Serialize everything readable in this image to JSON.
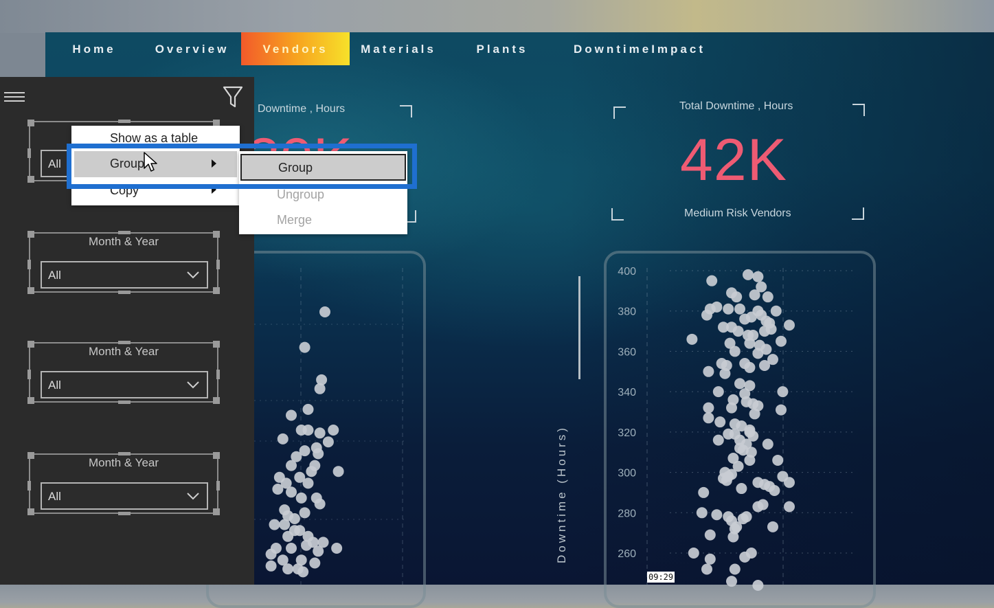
{
  "nav": {
    "tabs": [
      {
        "label": "Home",
        "active": false
      },
      {
        "label": "Overview",
        "active": false
      },
      {
        "label": "Vendors",
        "active": true
      },
      {
        "label": "Materials",
        "active": false
      },
      {
        "label": "Plants",
        "active": false
      },
      {
        "label": "DowntimeImpact",
        "active": false
      }
    ]
  },
  "filter_pane": {
    "menu_icon": "hamburger-icon",
    "filter_icon": "funnel-icon",
    "slicers": [
      {
        "title": "Month & Year",
        "value": "All"
      },
      {
        "title": "Month & Year",
        "value": "All"
      },
      {
        "title": "Month & Year",
        "value": "All"
      },
      {
        "title": "Month & Year",
        "value": "All"
      }
    ]
  },
  "context_menu": {
    "items": [
      {
        "label": "Show as a table",
        "has_submenu": false
      },
      {
        "label": "Group",
        "has_submenu": true,
        "hovered": true
      },
      {
        "label": "Copy",
        "has_submenu": true
      }
    ],
    "submenu": [
      {
        "label": "Group",
        "enabled": true,
        "focused": true
      },
      {
        "label": "Ungroup",
        "enabled": false
      },
      {
        "label": "Merge",
        "enabled": false
      }
    ]
  },
  "kpis": [
    {
      "title": "Downtime , Hours",
      "value": "",
      "subtitle": ""
    },
    {
      "title": "Total Downtime , Hours",
      "value": "42K",
      "subtitle": "Medium Risk Vendors"
    }
  ],
  "colors": {
    "kpi_value": "#ee5b73",
    "active_tab_start": "#f25a2a",
    "active_tab_end": "#f7e12a",
    "highlight": "#1f6fd0",
    "point": "#c8ccd2"
  },
  "timestamp": "09:29",
  "chart_data": [
    {
      "type": "scatter",
      "title": "",
      "xlabel": "",
      "ylabel": "Downtime (Hours)",
      "ylim": [
        240,
        405
      ],
      "xlim": [
        0,
        100
      ],
      "yticks": [
        400,
        380,
        360,
        340,
        320,
        300,
        280,
        260
      ],
      "grid": true,
      "points": [
        [
          38,
          395
        ],
        [
          60,
          398
        ],
        [
          66,
          397
        ],
        [
          68,
          392
        ],
        [
          50,
          389
        ],
        [
          53,
          387
        ],
        [
          64,
          388
        ],
        [
          72,
          387
        ],
        [
          37,
          381
        ],
        [
          41,
          382
        ],
        [
          48,
          381
        ],
        [
          55,
          381
        ],
        [
          66,
          380
        ],
        [
          68,
          378
        ],
        [
          77,
          380
        ],
        [
          35,
          378
        ],
        [
          58,
          376
        ],
        [
          62,
          377
        ],
        [
          71,
          375
        ],
        [
          73,
          374
        ],
        [
          85,
          373
        ],
        [
          45,
          372
        ],
        [
          50,
          372
        ],
        [
          54,
          370
        ],
        [
          60,
          368
        ],
        [
          63,
          368
        ],
        [
          70,
          370
        ],
        [
          74,
          371
        ],
        [
          26,
          366
        ],
        [
          49,
          364
        ],
        [
          61,
          364
        ],
        [
          67,
          363
        ],
        [
          80,
          365
        ],
        [
          52,
          360
        ],
        [
          66,
          359
        ],
        [
          71,
          361
        ],
        [
          75,
          356
        ],
        [
          44,
          354
        ],
        [
          47,
          353
        ],
        [
          58,
          354
        ],
        [
          61,
          352
        ],
        [
          70,
          353
        ],
        [
          36,
          350
        ],
        [
          46,
          349
        ],
        [
          55,
          344
        ],
        [
          61,
          343
        ],
        [
          42,
          340
        ],
        [
          81,
          340
        ],
        [
          58,
          339
        ],
        [
          51,
          336
        ],
        [
          59,
          335
        ],
        [
          63,
          334
        ],
        [
          66,
          333
        ],
        [
          36,
          332
        ],
        [
          50,
          332
        ],
        [
          80,
          331
        ],
        [
          64,
          329
        ],
        [
          36,
          327
        ],
        [
          43,
          325
        ],
        [
          52,
          324
        ],
        [
          56,
          323
        ],
        [
          61,
          321
        ],
        [
          48,
          319
        ],
        [
          52,
          319
        ],
        [
          61,
          320
        ],
        [
          63,
          318
        ],
        [
          42,
          316
        ],
        [
          55,
          316
        ],
        [
          59,
          314
        ],
        [
          72,
          314
        ],
        [
          55,
          312
        ],
        [
          57,
          311
        ],
        [
          62,
          310
        ],
        [
          51,
          307
        ],
        [
          61,
          306
        ],
        [
          78,
          306
        ],
        [
          54,
          303
        ],
        [
          46,
          300
        ],
        [
          48,
          298
        ],
        [
          50,
          299
        ],
        [
          45,
          297
        ],
        [
          47,
          296
        ],
        [
          81,
          298
        ],
        [
          85,
          295
        ],
        [
          66,
          295
        ],
        [
          70,
          294
        ],
        [
          73,
          293
        ],
        [
          56,
          292
        ],
        [
          33,
          290
        ],
        [
          76,
          291
        ],
        [
          66,
          283
        ],
        [
          69,
          284
        ],
        [
          85,
          283
        ],
        [
          32,
          280
        ],
        [
          41,
          279
        ],
        [
          48,
          278
        ],
        [
          50,
          276
        ],
        [
          57,
          277
        ],
        [
          59,
          278
        ],
        [
          53,
          273
        ],
        [
          52,
          272
        ],
        [
          75,
          273
        ],
        [
          37,
          269
        ],
        [
          51,
          268
        ],
        [
          27,
          260
        ],
        [
          62,
          260
        ],
        [
          37,
          257
        ],
        [
          58,
          258
        ],
        [
          35,
          252
        ],
        [
          52,
          252
        ],
        [
          50,
          246
        ],
        [
          66,
          244
        ]
      ]
    },
    {
      "type": "scatter",
      "title": "",
      "xlabel": "",
      "ylabel": "",
      "note": "partially occluded chart; y-axis not visible",
      "points_pixel_relative": "scaled 0-100 within visible plot",
      "points": [
        [
          40,
          90
        ],
        [
          28,
          78
        ],
        [
          38,
          67
        ],
        [
          37,
          64
        ],
        [
          30,
          57
        ],
        [
          20,
          55
        ],
        [
          26,
          50
        ],
        [
          30,
          50
        ],
        [
          45,
          50
        ],
        [
          37,
          49
        ],
        [
          15,
          47
        ],
        [
          42,
          46
        ],
        [
          28,
          43
        ],
        [
          35,
          44
        ],
        [
          36,
          42
        ],
        [
          23,
          41
        ],
        [
          20,
          38
        ],
        [
          34,
          38
        ],
        [
          32,
          36
        ],
        [
          48,
          36
        ],
        [
          25,
          34
        ],
        [
          13,
          34
        ],
        [
          17,
          32
        ],
        [
          30,
          32
        ],
        [
          12,
          30
        ],
        [
          20,
          29
        ],
        [
          26,
          27
        ],
        [
          35,
          27
        ],
        [
          37,
          25
        ],
        [
          16,
          23
        ],
        [
          18,
          21
        ],
        [
          22,
          20
        ],
        [
          28,
          22
        ],
        [
          16,
          18
        ],
        [
          22,
          16
        ],
        [
          10,
          18
        ],
        [
          25,
          16
        ],
        [
          18,
          14
        ],
        [
          30,
          14
        ],
        [
          33,
          12
        ],
        [
          39,
          12
        ],
        [
          11,
          10
        ],
        [
          20,
          10
        ],
        [
          29,
          11
        ],
        [
          36,
          9
        ],
        [
          47,
          10
        ],
        [
          8,
          8
        ],
        [
          15,
          6
        ],
        [
          26,
          6
        ],
        [
          34,
          5
        ],
        [
          8,
          4
        ],
        [
          18,
          3
        ],
        [
          24,
          3
        ],
        [
          27,
          2
        ]
      ]
    }
  ]
}
